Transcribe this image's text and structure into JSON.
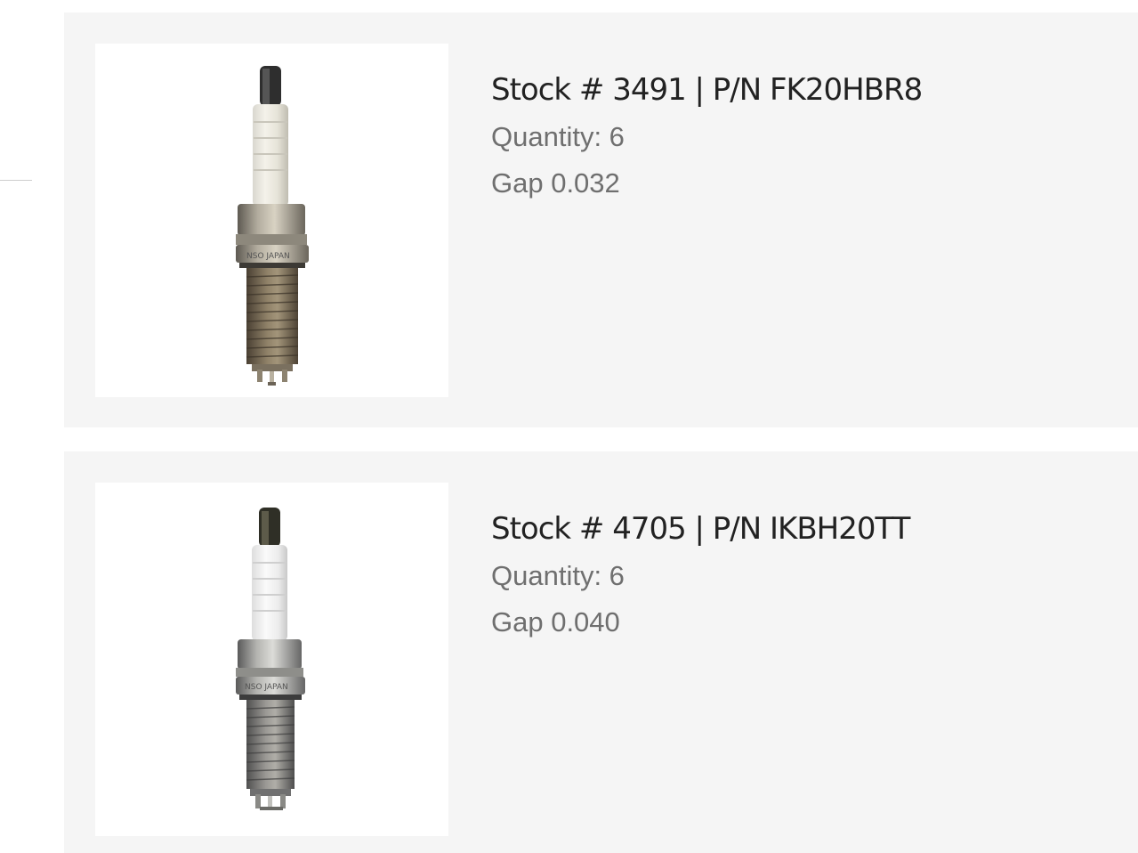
{
  "items": [
    {
      "title": "Stock # 3491 | P/N FK20HBR8",
      "quantity": "Quantity: 6",
      "gap": "Gap 0.032",
      "image": "spark-plug-iridium"
    },
    {
      "title": "Stock # 4705 | P/N IKBH20TT",
      "quantity": "Quantity: 6",
      "gap": "Gap 0.040",
      "image": "spark-plug-twin-tip"
    }
  ],
  "colors": {
    "card_background": "#f5f5f5",
    "title_text": "#222222",
    "detail_text": "#6f6f6f"
  }
}
